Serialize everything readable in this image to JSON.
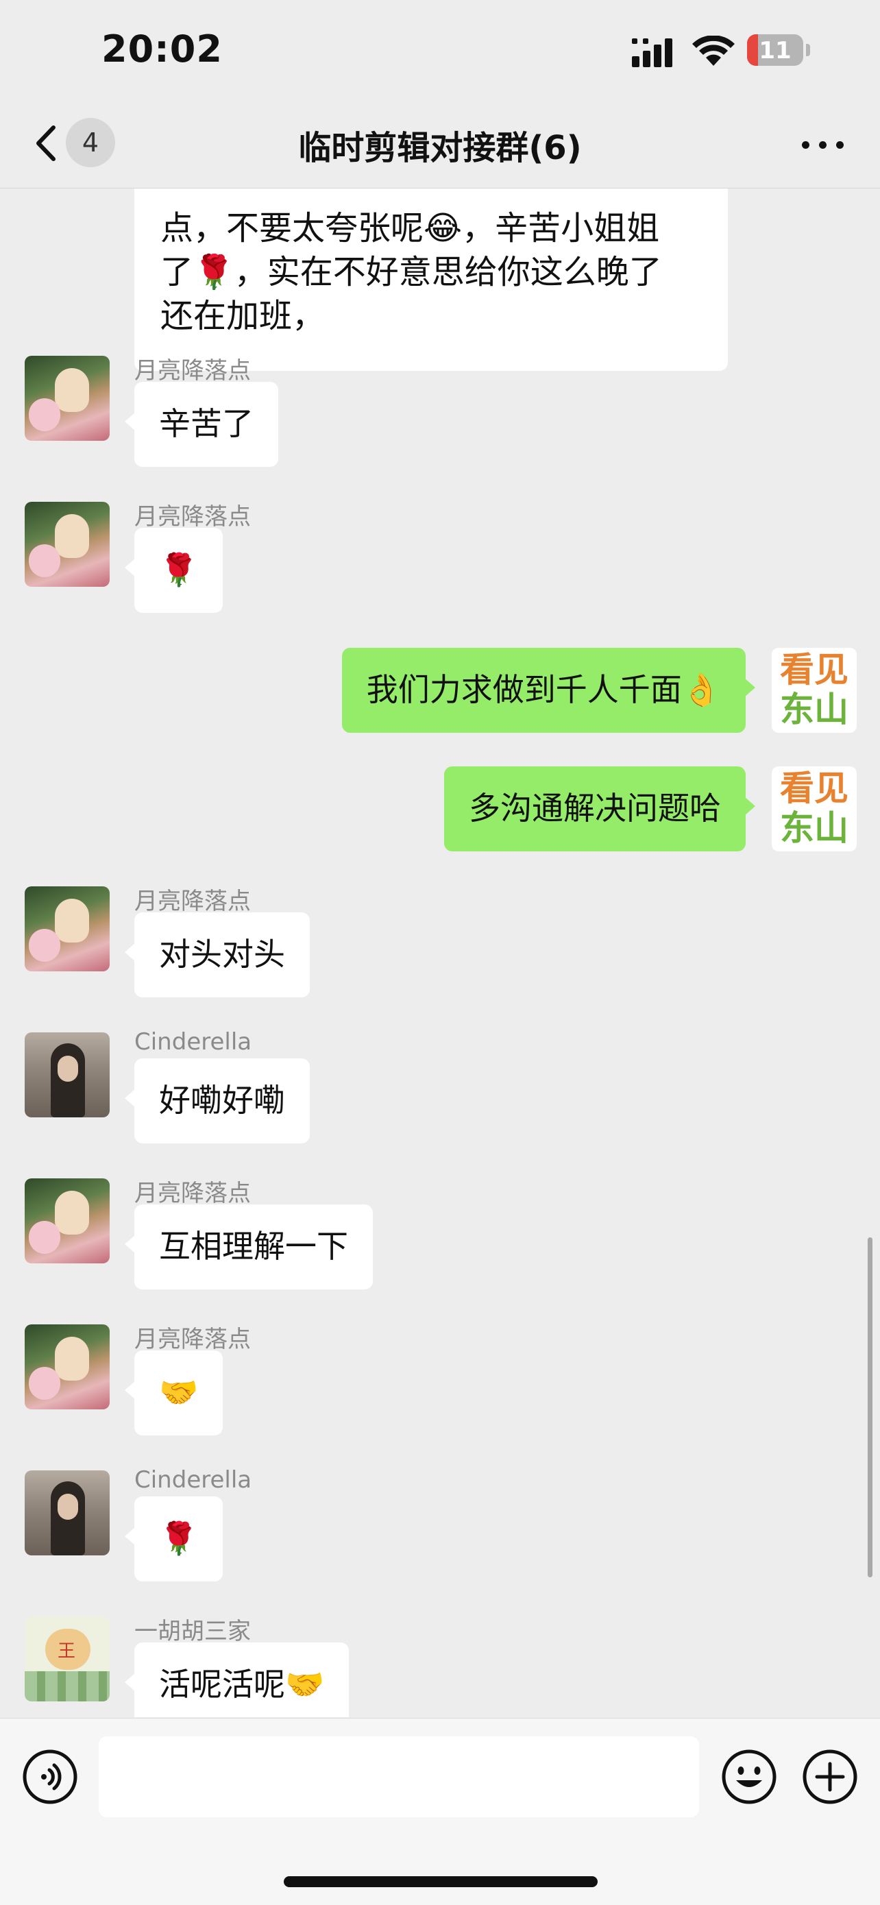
{
  "status_bar": {
    "time": "20:02",
    "battery": "11"
  },
  "nav": {
    "back_badge": "4",
    "title": "临时剪辑对接群(6)"
  },
  "messages": [
    {
      "type": "in",
      "text_lines": [
        "点，不要太夸张呢😂，辛苦小姐姐",
        "了🌹，实在不好意思给你这么晚了",
        "还在加班，"
      ]
    },
    {
      "type": "in",
      "sender": "月亮降落点",
      "text": "辛苦了"
    },
    {
      "type": "in",
      "sender": "月亮降落点",
      "text": "🌹"
    },
    {
      "type": "out",
      "text": "我们力求做到千人千面👌"
    },
    {
      "type": "out",
      "text": "多沟通解决问题哈"
    },
    {
      "type": "in",
      "sender": "月亮降落点",
      "text": "对头对头"
    },
    {
      "type": "in",
      "sender": "Cinderella",
      "text": "好嘞好嘞"
    },
    {
      "type": "in",
      "sender": "月亮降落点",
      "text": "互相理解一下"
    },
    {
      "type": "in",
      "sender": "月亮降落点",
      "text": "🤝"
    },
    {
      "type": "in",
      "sender": "Cinderella",
      "text": "🌹"
    },
    {
      "type": "in",
      "sender": "一胡胡三家",
      "text": "活呢活呢🤝"
    }
  ],
  "my_avatar": {
    "line1": "看见",
    "line2": "东山"
  },
  "hu_avatar_text": "王",
  "input": {
    "placeholder": ""
  },
  "icons": {
    "back": "chevron-left-icon",
    "more": "more-dots-icon",
    "voice": "voice-icon",
    "emoji": "emoji-icon",
    "plus": "plus-icon"
  },
  "colors": {
    "bubble_out": "#95ec69",
    "bubble_in": "#ffffff",
    "background": "#ededed"
  }
}
